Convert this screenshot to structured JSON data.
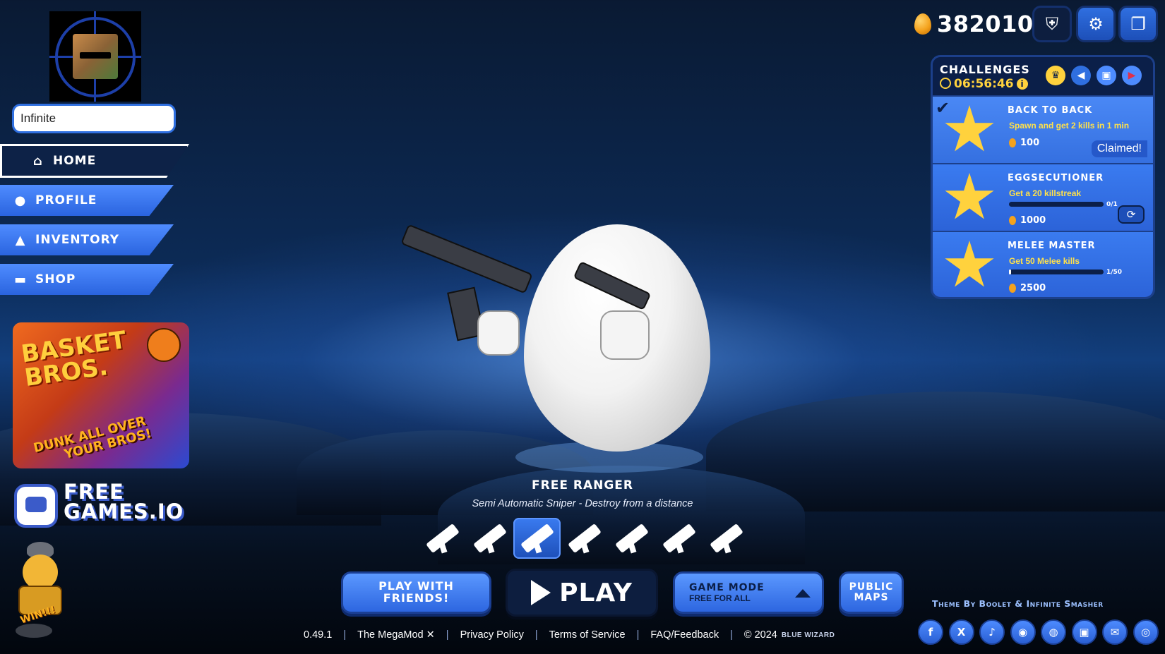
{
  "player": {
    "name": "Infinite"
  },
  "nav": {
    "home": "Home",
    "profile": "Profile",
    "inventory": "Inventory",
    "shop": "Shop"
  },
  "ad": {
    "title_line1": "BASKET",
    "title_line2": "BROS.",
    "tagline_line1": "DUNK ALL OVER",
    "tagline_line2": "YOUR BROS!"
  },
  "freegames": {
    "line1": "FREE",
    "line2": "GAMES.IO"
  },
  "chick_badge": "WIN!!!",
  "currency": {
    "eggs": "382010"
  },
  "challenges": {
    "title": "Challenges",
    "timer": "06:56:46",
    "items": [
      {
        "name": "Back to Back",
        "desc": "Spawn and get 2 kills in 1 min",
        "reward": "100",
        "status": "Claimed!"
      },
      {
        "name": "Eggsecutioner",
        "desc": "Get a 20 killstreak",
        "reward": "1000",
        "progress_text": "0/1",
        "progress": 0
      },
      {
        "name": "Melee Master",
        "desc": "Get 50 Melee kills",
        "reward": "2500",
        "progress_text": "1/50",
        "progress": 0.02
      }
    ]
  },
  "weapon": {
    "name": "Free Ranger",
    "desc": "Semi Automatic Sniper - Destroy from a distance",
    "selected_index": 2
  },
  "buttons": {
    "play_friends_line1": "Play with",
    "play_friends_line2": "Friends!",
    "play": "Play",
    "game_mode_label": "Game Mode",
    "game_mode_value": "Free For All",
    "public_maps_line1": "Public",
    "public_maps_line2": "Maps"
  },
  "theme_credit": "Theme By Boolet & Infinite Smasher",
  "footer": {
    "version": "0.49.1",
    "megamod": "The MegaMod",
    "privacy": "Privacy Policy",
    "terms": "Terms of Service",
    "faq": "FAQ/Feedback",
    "copyright": "© 2024",
    "bluewizard": "BLUE WIZARD"
  },
  "socials": [
    "facebook-icon",
    "x-icon",
    "tiktok-icon",
    "discord-icon",
    "steam-icon",
    "twitch-icon",
    "newsletter-icon",
    "instagram-icon"
  ]
}
